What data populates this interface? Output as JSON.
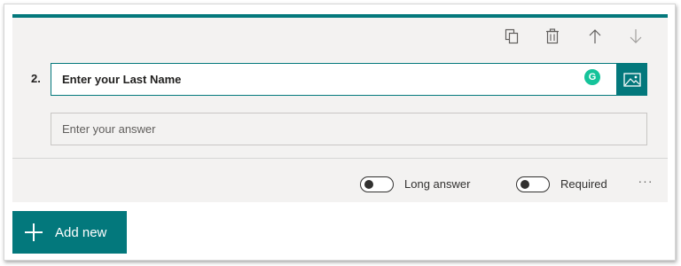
{
  "question": {
    "number": "2.",
    "title": "Enter your Last Name",
    "answer_placeholder": "Enter your answer"
  },
  "toolbar": {
    "icons": [
      "copy-icon",
      "delete-icon",
      "move-up-icon",
      "move-down-icon"
    ]
  },
  "grammarly_glyph": "G",
  "options": {
    "long_answer_label": "Long answer",
    "long_answer_on": false,
    "required_label": "Required",
    "required_on": false,
    "more_label": "···"
  },
  "add_new": {
    "label": "Add new"
  },
  "colors": {
    "accent": "#03787c",
    "card_background": "#f3f2f1",
    "grammarly": "#15c39a"
  }
}
